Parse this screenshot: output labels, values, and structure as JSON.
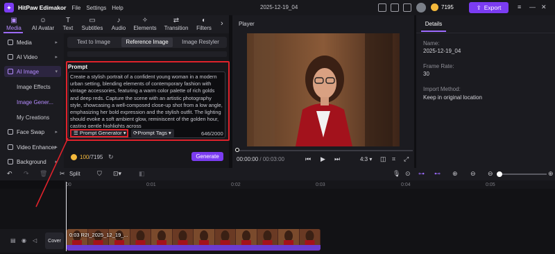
{
  "app": {
    "title": "HitPaw Edimakor",
    "menu": [
      "File",
      "Settings",
      "Help"
    ],
    "project_name": "2025-12-19_04",
    "coins": "7195",
    "export_label": "Export"
  },
  "toolbar": {
    "tabs": [
      {
        "label": "Media",
        "icon": "media-icon"
      },
      {
        "label": "AI Avatar",
        "icon": "avatar-icon"
      },
      {
        "label": "Text",
        "icon": "text-icon"
      },
      {
        "label": "Subtitles",
        "icon": "subtitles-icon"
      },
      {
        "label": "Audio",
        "icon": "audio-icon"
      },
      {
        "label": "Elements",
        "icon": "elements-icon"
      },
      {
        "label": "Transition",
        "icon": "transition-icon"
      },
      {
        "label": "Filters",
        "icon": "filters-icon"
      }
    ]
  },
  "sidebar": {
    "items": [
      "Media",
      "AI Video",
      "AI Image",
      "Face Swap",
      "Video Enhancer",
      "Background"
    ],
    "subitems": [
      "Image Effects",
      "Image Gener...",
      "My Creations"
    ]
  },
  "panel": {
    "modes": [
      "Text to Image",
      "Reference Image",
      "Image Restyler"
    ],
    "prompt_label": "Prompt",
    "prompt_text": "Create a stylish portrait of a confident young woman in a modern urban setting, blending elements of contemporary fashion with vintage accessories, featuring a warm color palette of rich golds and deep reds. Capture the scene with an artistic photography style, showcasing a well-composed close-up shot from a low angle, emphasizing her bold expression and the stylish outfit. The lighting should evoke a soft ambient glow, reminiscent of the golden hour, casting gentle highlights across",
    "prompt_generator_label": "Prompt Generator",
    "prompt_tags_label": "Prompt Tags",
    "char_count": "646/2000",
    "credits_used": "100",
    "credits_total": "/7195",
    "generate_label": "Generate"
  },
  "player": {
    "label": "Player",
    "current_time": "00:00:00",
    "total_time": "/ 00:03:00",
    "ratio": "4:3"
  },
  "details": {
    "tab": "Details",
    "fields": [
      {
        "label": "Name:",
        "value": "2025-12-19_04"
      },
      {
        "label": "Frame Rate:",
        "value": "30"
      },
      {
        "label": "Import Method:",
        "value": "Keep in original location"
      }
    ]
  },
  "timeline": {
    "split_label": "Split",
    "ticks": [
      "00",
      "0:01",
      "0:02",
      "0:03",
      "0:04",
      "0:05"
    ],
    "cover_label": "Cover",
    "clip_label": "0:03 R2I_2025_12_19_..."
  },
  "colors": {
    "accent": "#7b3cf2",
    "highlight_red": "#e0222b",
    "coin": "#f4b93c"
  }
}
